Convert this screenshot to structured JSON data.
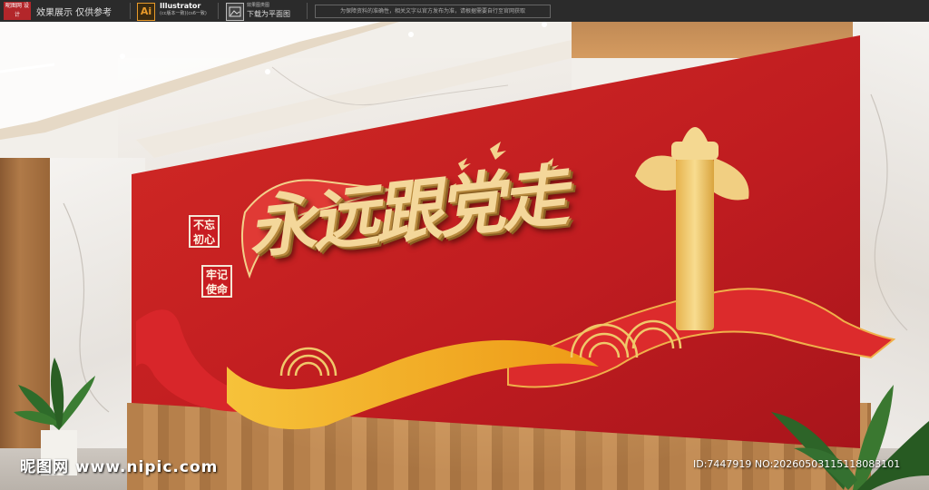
{
  "topbar": {
    "logo_text": "昵图网 设计",
    "preview_label": "效果展示 仅供参考",
    "software_name": "Illustrator",
    "software_version": "(cc版本一致)(cs6一致)",
    "image_type_small": "效果图类图",
    "image_type_label": "下载为平面图",
    "notice": "为保障资料的准确性，相关文字以官方发布为准，请根据需要自行至官网获取"
  },
  "wall": {
    "slogan": "永远跟党走",
    "badge_1": [
      "不忘",
      "初心"
    ],
    "badge_2": [
      "牢记",
      "使命"
    ]
  },
  "watermark": {
    "site": "昵图网 www.nipic.com",
    "id_text": "ID:7447919 NO:20260503115118083101"
  },
  "colors": {
    "panel_red": "#c41f22",
    "gold": "#f0c45a",
    "ribbon_red": "#d8262a",
    "ribbon_yellow": "#f2b01f"
  }
}
